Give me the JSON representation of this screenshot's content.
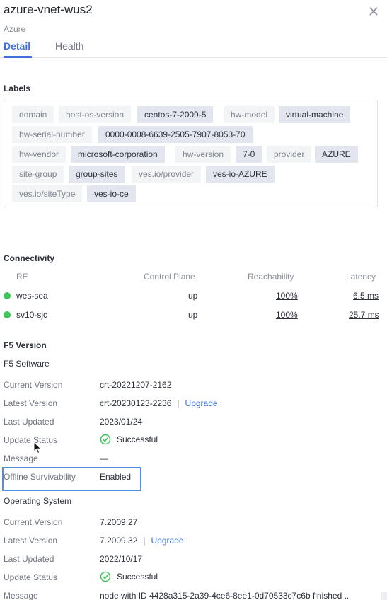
{
  "header": {
    "title": "azure-vnet-wus2",
    "subtitle": "Azure"
  },
  "tabs": [
    {
      "label": "Detail"
    },
    {
      "label": "Health"
    }
  ],
  "labels": {
    "title": "Labels",
    "items": [
      {
        "key": "domain",
        "value": ""
      },
      {
        "key": "host-os-version",
        "value": "centos-7-2009-5"
      },
      {
        "key": "hw-model",
        "value": "virtual-machine"
      },
      {
        "key": "hw-serial-number",
        "value": "0000-0008-6639-2505-7907-8053-70"
      },
      {
        "key": "hw-vendor",
        "value": "microsoft-corporation"
      },
      {
        "key": "hw-version",
        "value": "7-0"
      },
      {
        "key": "provider",
        "value": "AZURE"
      },
      {
        "key": "site-group",
        "value": "group-sites"
      },
      {
        "key": "ves.io/provider",
        "value": "ves-io-AZURE"
      },
      {
        "key": "ves.io/siteType",
        "value": "ves-io-ce"
      }
    ]
  },
  "connectivity": {
    "title": "Connectivity",
    "headers": {
      "re": "RE",
      "control_plane": "Control Plane",
      "reachability": "Reachability",
      "latency": "Latency"
    },
    "rows": [
      {
        "re": "wes-sea",
        "control_plane": "up",
        "reachability": "100%",
        "latency": "6.5 ms"
      },
      {
        "re": "sv10-sjc",
        "control_plane": "up",
        "reachability": "100%",
        "latency": "25.7 ms"
      }
    ],
    "status_color": "#3ec45a"
  },
  "f5_version": {
    "title": "F5 Version",
    "software": {
      "title": "F5 Software",
      "current_version_label": "Current Version",
      "current_version": "crt-20221207-2162",
      "latest_version_label": "Latest Version",
      "latest_version": "crt-20230123-2236",
      "upgrade_label": "Upgrade",
      "last_updated_label": "Last Updated",
      "last_updated": "2023/01/24",
      "update_status_label": "Update Status",
      "update_status": "Successful",
      "message_label": "Message",
      "message": "—",
      "offline_label": "Offline Survivability",
      "offline": "Enabled"
    },
    "os": {
      "title": "Operating System",
      "current_version_label": "Current Version",
      "current_version": "7.2009.27",
      "latest_version_label": "Latest Version",
      "latest_version": "7.2009.32",
      "upgrade_label": "Upgrade",
      "last_updated_label": "Last Updated",
      "last_updated": "2022/10/17",
      "update_status_label": "Update Status",
      "update_status": "Successful",
      "message_label": "Message",
      "message": "node with ID 4428a315-2a39-4ce6-8ee1-0d70533c7c6b finished .."
    }
  },
  "colors": {
    "accent": "#3f6fd8",
    "success": "#3ec45a",
    "highlight": "#4d90e0"
  },
  "icons": {
    "close": "close-icon",
    "success": "check-circle-icon",
    "cursor": "mouse-pointer-icon"
  }
}
